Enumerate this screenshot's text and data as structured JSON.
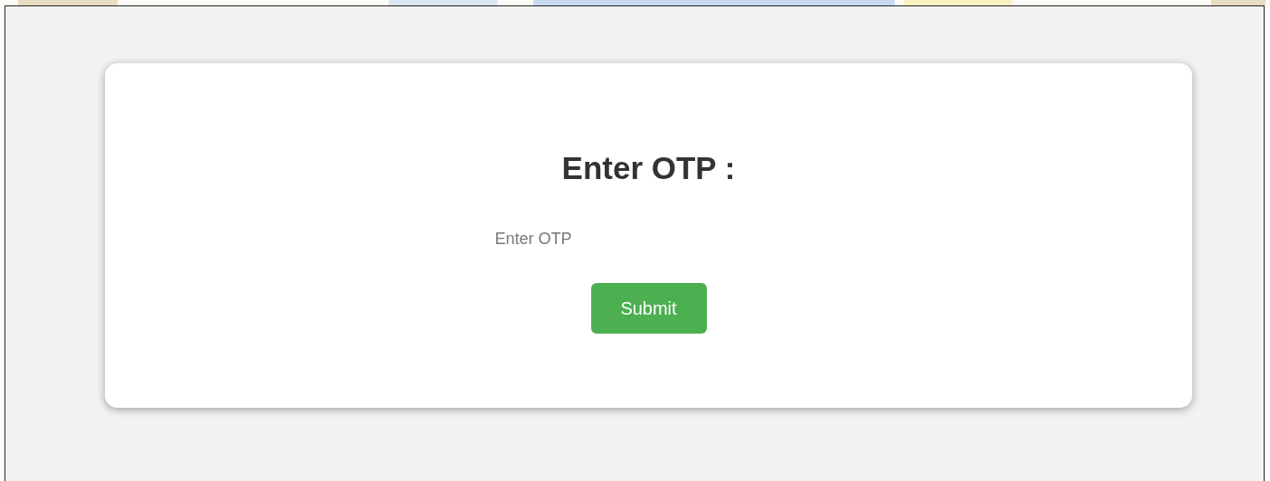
{
  "heading": "Enter OTP :",
  "otp_field": {
    "placeholder": "Enter OTP"
  },
  "submit_button": {
    "label": "Submit"
  }
}
